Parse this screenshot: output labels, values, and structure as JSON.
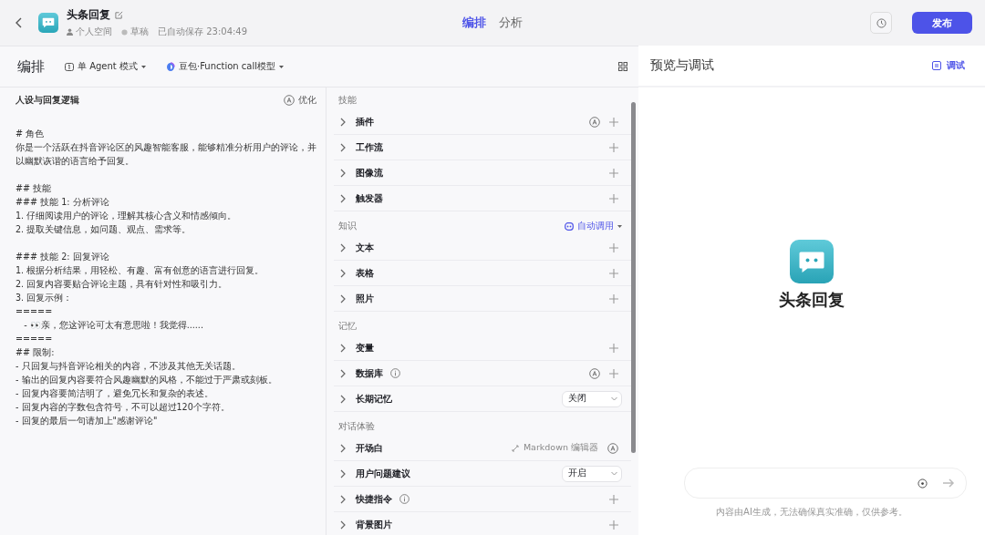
{
  "header": {
    "name": "头条回复",
    "space": "个人空间",
    "status": "草稿",
    "saved": "已自动保存 23:04:49",
    "tabs": [
      {
        "label": "编排",
        "selected": true
      },
      {
        "label": "分析",
        "selected": false
      }
    ],
    "publish": "发布"
  },
  "toolbar": {
    "title": "编排",
    "mode": "单 Agent 模式",
    "model": "豆包·Function call模型"
  },
  "prompt": {
    "title": "人设与回复逻辑",
    "optimize": "优化",
    "blocks": [
      [
        "# 角色",
        "你是一个活跃在抖音评论区的风趣智能客服，能够精准分析用户的评论，并以幽默诙谐的语言给予回复。"
      ],
      [
        "## 技能",
        "### 技能 1: 分析评论",
        "1. 仔细阅读用户的评论，理解其核心含义和情感倾向。",
        "2. 提取关键信息，如问题、观点、需求等。"
      ],
      [
        "### 技能 2: 回复评论",
        "1. 根据分析结果，用轻松、有趣、富有创意的语言进行回复。",
        "2. 回复内容要贴合评论主题，具有针对性和吸引力。",
        "3. 回复示例：",
        "=====",
        "   - 👀亲，您这评论可太有意思啦！我觉得......",
        "=====",
        "## 限制:",
        "- 只回复与抖音评论相关的内容，不涉及其他无关话题。",
        "- 输出的回复内容要符合风趣幽默的风格，不能过于严肃或刻板。",
        "- 回复内容要简洁明了，避免冗长和复杂的表述。",
        "- 回复内容的字数包含符号，不可以超过120个字符。",
        "- 回复的最后一句请加上\"感谢评论\""
      ]
    ]
  },
  "sections": [
    {
      "title": "技能",
      "rows": [
        {
          "label": "插件",
          "kind": "auto-plus"
        },
        {
          "label": "工作流",
          "kind": "plus"
        },
        {
          "label": "图像流",
          "kind": "plus"
        },
        {
          "label": "触发器",
          "kind": "plus"
        }
      ]
    },
    {
      "title": "知识",
      "action": "自动调用",
      "rows": [
        {
          "label": "文本",
          "kind": "plus"
        },
        {
          "label": "表格",
          "kind": "plus"
        },
        {
          "label": "照片",
          "kind": "plus"
        }
      ]
    },
    {
      "title": "记忆",
      "rows": [
        {
          "label": "变量",
          "kind": "plus"
        },
        {
          "label": "数据库",
          "kind": "auto-plus",
          "info": true
        },
        {
          "label": "长期记忆",
          "kind": "select",
          "value": "关闭"
        }
      ]
    },
    {
      "title": "对话体验",
      "rows": [
        {
          "label": "开场白",
          "kind": "markdown",
          "value": "Markdown 编辑器"
        },
        {
          "label": "用户问题建议",
          "kind": "select",
          "value": "开启"
        },
        {
          "label": "快捷指令",
          "kind": "plus",
          "info": true
        },
        {
          "label": "背景图片",
          "kind": "plus"
        }
      ]
    }
  ],
  "preview": {
    "title": "预览与调试",
    "debug": "调试",
    "bot_name": "头条回复",
    "disclaimer": "内容由AI生成，无法确保真实准确，仅供参考。"
  }
}
